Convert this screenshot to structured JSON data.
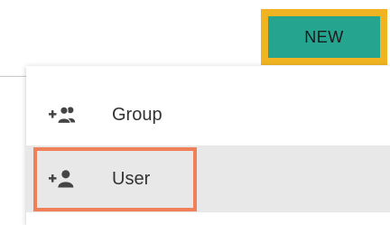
{
  "toolbar": {
    "new_label": "NEW"
  },
  "menu": {
    "items": [
      {
        "label": "Group",
        "icon": "add-group-icon"
      },
      {
        "label": "User",
        "icon": "add-user-icon"
      }
    ]
  },
  "colors": {
    "new_button_bg": "#25a48f",
    "new_highlight": "#f0b321",
    "user_highlight": "#f0805a",
    "hover_bg": "#e8e8e8"
  }
}
